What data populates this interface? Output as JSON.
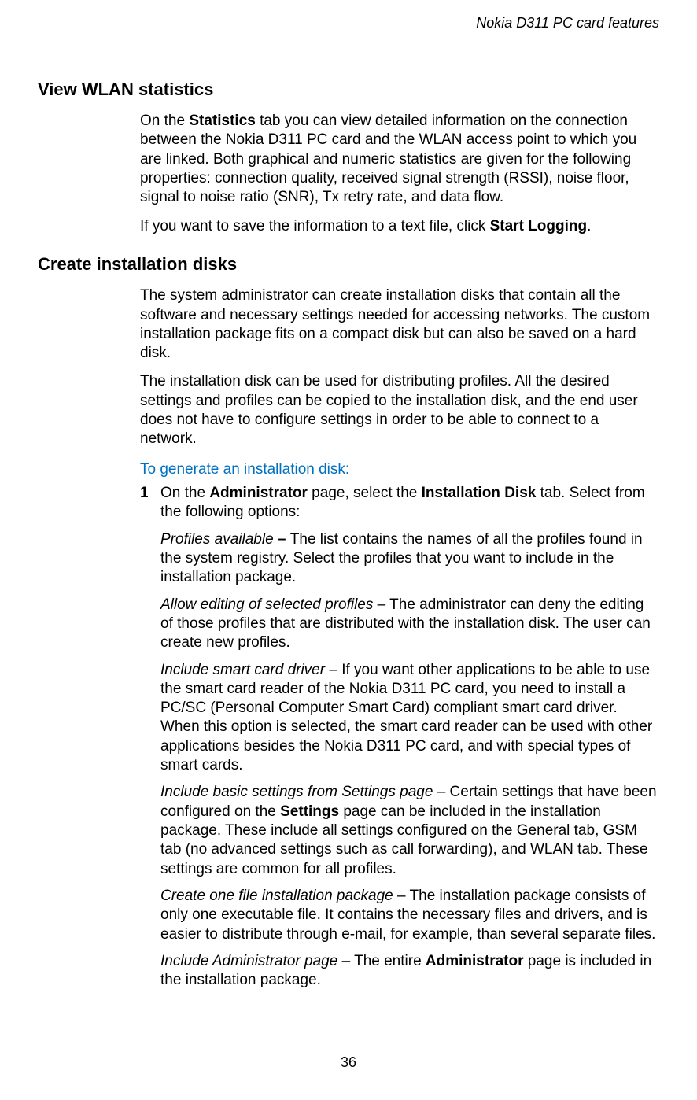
{
  "header": {
    "doc_title": "Nokia D311 PC card features"
  },
  "sections": {
    "wlan": {
      "heading": "View WLAN statistics",
      "p1_a": "On the ",
      "p1_b": "Statistics",
      "p1_c": " tab you can view detailed information on the connection between the Nokia D311 PC card and the WLAN access point to which you are linked. Both graphical and numeric statistics are given for the following properties: connection quality, received signal strength (RSSI), noise floor, signal to noise ratio (SNR), Tx retry rate, and data flow.",
      "p2_a": "If you want to save the information to a text file, click ",
      "p2_b": "Start Logging",
      "p2_c": "."
    },
    "create": {
      "heading": "Create installation disks",
      "p1": "The system administrator can create installation disks that contain all the software and necessary settings needed for accessing networks. The custom installation package fits on a compact disk but can also be saved on a hard disk.",
      "p2": "The installation disk can be used for distributing profiles. All the desired settings and profiles can be copied to the installation disk, and the end user does not have to configure settings in order to be able to connect to a network.",
      "step_label": "To generate an installation disk:",
      "step1": {
        "num": "1",
        "a": "On the ",
        "b": "Administrator",
        "c": " page, select the ",
        "d": "Installation Disk",
        "e": " tab. Select from the following options:"
      },
      "opt1": {
        "title": "Profiles available",
        "dash": " – ",
        "text": "The list contains the names of all the profiles found in the system registry. Select the profiles that you want to include in the installation package."
      },
      "opt2": {
        "title": "Allow editing of selected profiles",
        "dash": " – ",
        "text": "The administrator can deny the editing of those profiles that are distributed with the installation disk. The user can create new profiles."
      },
      "opt3": {
        "title": "Include smart card driver",
        "dash": " – ",
        "text": "If you want other applications to be able to use the smart card reader of the Nokia D311 PC card, you need to install a PC/SC (Personal Computer Smart Card) compliant smart card driver. When this option is selected, the smart card reader can be used with other applications besides the Nokia D311 PC card, and with special types of smart cards."
      },
      "opt4": {
        "title": "Include basic settings from Settings page",
        "dash": " – ",
        "text_a": "Certain settings that have been configured on the ",
        "text_b": "Settings",
        "text_c": " page can be included in the installation package. These include all settings configured on the General tab, GSM tab (no advanced settings such as call forwarding), and WLAN tab. These settings are common for all profiles."
      },
      "opt5": {
        "title": "Create one file installation package",
        "dash": " – ",
        "text": "The installation package consists of only one executable file. It contains the necessary files and drivers, and is easier to distribute through e-mail, for example, than several separate files."
      },
      "opt6": {
        "title": "Include Administrator page",
        "dash": " – ",
        "text_a": "The entire ",
        "text_b": "Administrator",
        "text_c": " page is included in the installation package."
      }
    }
  },
  "footer": {
    "page_number": "36"
  }
}
